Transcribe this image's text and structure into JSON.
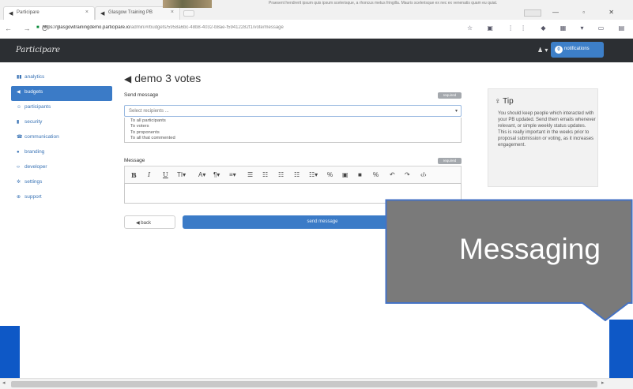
{
  "browser": {
    "tabs": [
      {
        "label": "Participare"
      },
      {
        "label": "Glasgow Training PB"
      }
    ],
    "banner_text": "Praesent hendrerit ipsum quis ipsum scelerisque, a rhoncus metus fringilla. Mauris scelerisque ex nec ex venenatis quam eu quiat.",
    "url_host": "https://glasgowtrainingdemo.participare.io",
    "url_path": "/admin/#/budgets/5958a6bc-48b8-4032-b8ae-f59412282f1/vote/message",
    "window_controls": "— ▫ ✕",
    "nav_icons": "← → C"
  },
  "app": {
    "brand": "Participare",
    "user_icon": "♟ ▾",
    "notifications_count": "0",
    "notifications_label": "notifications"
  },
  "sidebar": {
    "items": [
      {
        "icon": "▮▮",
        "label": "analytics"
      },
      {
        "icon": "◀",
        "label": "budgets"
      },
      {
        "icon": "☺",
        "label": "participants"
      },
      {
        "icon": "▮",
        "label": "security"
      },
      {
        "icon": "☎",
        "label": "communication"
      },
      {
        "icon": "●",
        "label": "branding"
      },
      {
        "icon": "‹›",
        "label": "developer"
      },
      {
        "icon": "✲",
        "label": "settings"
      },
      {
        "icon": "⊕",
        "label": "support"
      }
    ]
  },
  "main": {
    "title": "demo 3 votes",
    "send_message_label": "Send message",
    "required_label": "required",
    "recipients_placeholder": "Select recipients ...",
    "recipient_options": [
      "To all participants",
      "To voters",
      "To proponents",
      "To all that commented"
    ],
    "message_label": "Message",
    "toolbar": [
      "B",
      "I",
      "U",
      "TI▾",
      "A▾",
      "¶▾",
      "≡▾",
      "☰",
      "☷",
      "☷",
      "☷",
      "☷▾",
      "%",
      "▣",
      "■",
      "%",
      "↶",
      "↷",
      "‹/›"
    ],
    "back_label": "back",
    "send_label": "send message"
  },
  "tip": {
    "title": "Tip",
    "text": "You should keep people which interacted with your PB updated. Send them emails whenever relevant, or simple weekly status updates. This is really important in the weeks prior to proposal submission or voting, as it increases engagement."
  },
  "callout": {
    "text": "Messaging",
    "fill": "#7a7a7a",
    "border": "#4472c4"
  },
  "colors": {
    "accent": "#3b7bc7",
    "header": "#2c2f33",
    "slide_blue": "#0e58c6"
  }
}
